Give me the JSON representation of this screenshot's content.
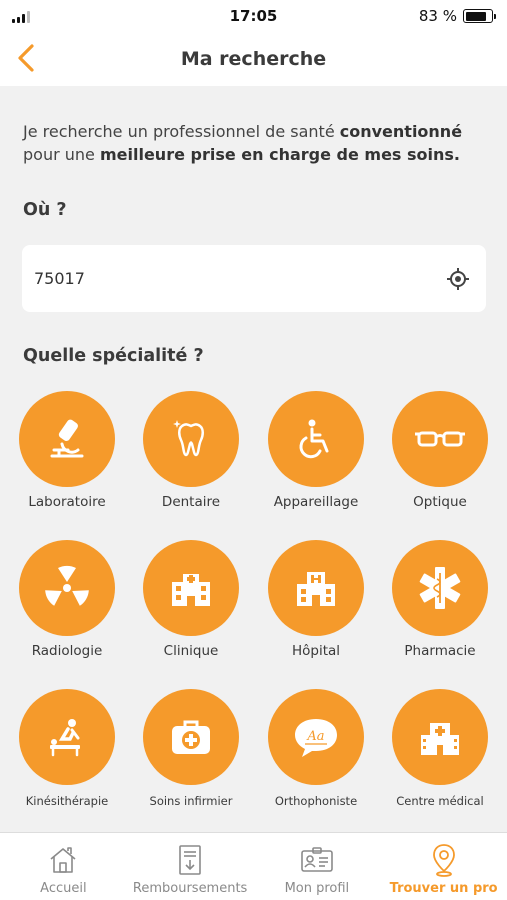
{
  "status_bar": {
    "time": "17:05",
    "battery": "83 %",
    "battery_level": 0.83
  },
  "header": {
    "title": "Ma recherche"
  },
  "intro": {
    "part1": "Je recherche un professionnel de santé ",
    "bold1": "conventionné",
    "part2": " pour une ",
    "bold2": "meilleure prise en charge de mes soins."
  },
  "location": {
    "label": "Où ?",
    "value": "75017"
  },
  "specialty": {
    "label": "Quelle spécialité ?",
    "items": [
      {
        "label": "Laboratoire",
        "icon": "microscope-icon"
      },
      {
        "label": "Dentaire",
        "icon": "tooth-icon"
      },
      {
        "label": "Appareillage",
        "icon": "wheelchair-icon"
      },
      {
        "label": "Optique",
        "icon": "glasses-icon"
      },
      {
        "label": "Radiologie",
        "icon": "radiation-icon"
      },
      {
        "label": "Clinique",
        "icon": "clinic-building-icon"
      },
      {
        "label": "Hôpital",
        "icon": "hospital-icon"
      },
      {
        "label": "Pharmacie",
        "icon": "star-of-life-icon"
      },
      {
        "label": "Kinésithérapie",
        "icon": "massage-table-icon"
      },
      {
        "label": "Soins infirmier",
        "icon": "first-aid-kit-icon"
      },
      {
        "label": "Orthophoniste",
        "icon": "speech-bubble-icon"
      },
      {
        "label": "Centre médical",
        "icon": "medical-center-icon"
      }
    ]
  },
  "tabbar": {
    "items": [
      {
        "label": "Accueil",
        "icon": "home-icon",
        "active": false
      },
      {
        "label": "Remboursements",
        "icon": "document-icon",
        "active": false
      },
      {
        "label": "Mon profil",
        "icon": "id-card-icon",
        "active": false
      },
      {
        "label": "Trouver un pro",
        "icon": "map-pin-icon",
        "active": true
      }
    ]
  },
  "colors": {
    "accent": "#f59a2b",
    "background": "#f1f1f1",
    "text": "#3a3a3a",
    "tab_inactive": "#8a8a8a"
  }
}
